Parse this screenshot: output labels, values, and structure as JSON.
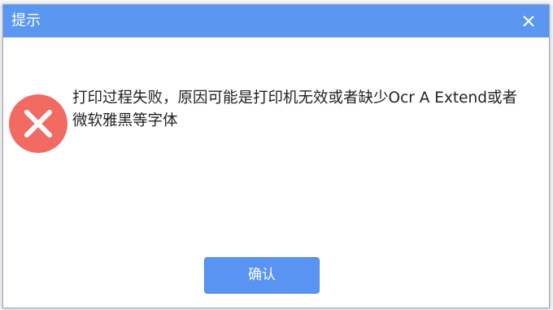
{
  "dialog": {
    "title": "提示",
    "close_icon": "close-icon",
    "error_icon": "error-circle-x-icon",
    "message": "打印过程失败，原因可能是打印机无效或者缺少Ocr A Extend或者微软雅黑等字体",
    "ok_label": "确认"
  },
  "colors": {
    "titlebar": "#5b96f0",
    "error": "#f26b62",
    "button": "#5a94f2"
  }
}
